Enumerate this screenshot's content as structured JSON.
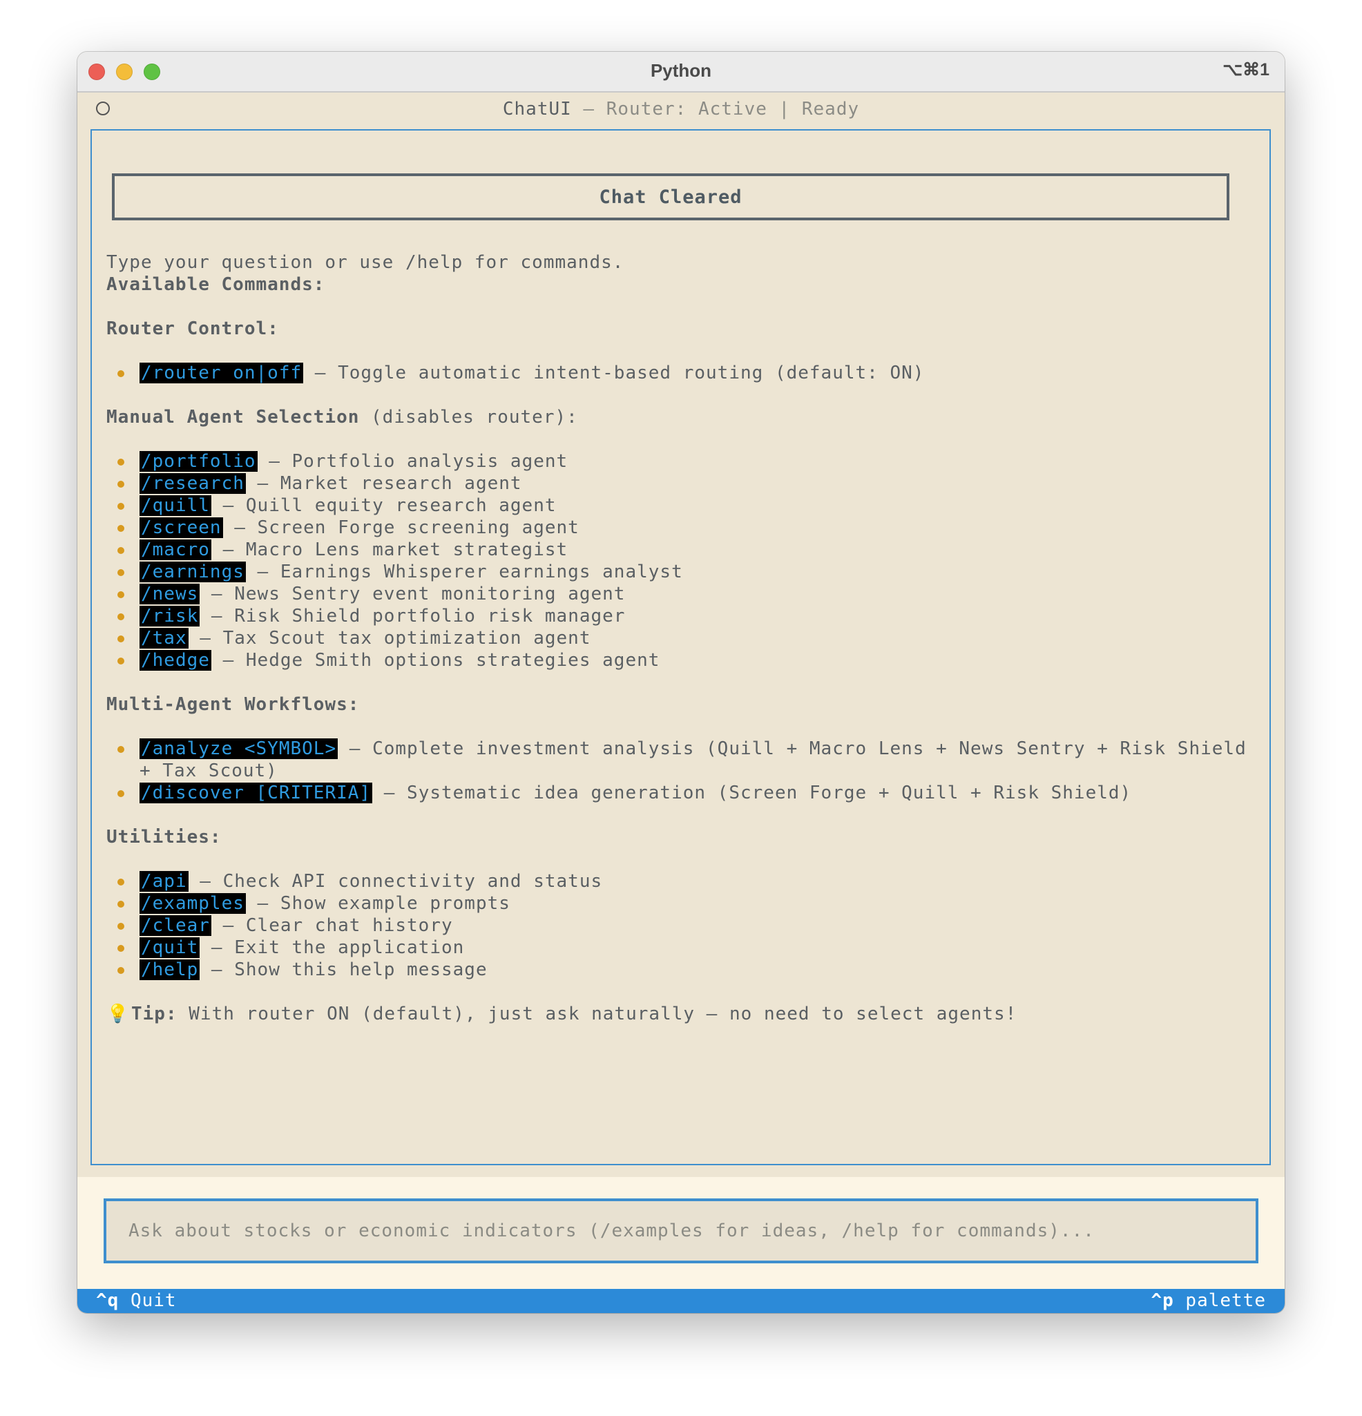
{
  "window": {
    "title": "Python",
    "shortcut": "⌥⌘1"
  },
  "header": {
    "app": "ChatUI",
    "separator": " — ",
    "status": "Router: Active | Ready"
  },
  "banner": {
    "text": "Chat Cleared"
  },
  "intro": "Type your question or use /help for commands.",
  "commands_heading": "Available Commands:",
  "sections": {
    "router": {
      "heading": "Router Control:",
      "items": [
        {
          "cmd": "/router on|off",
          "desc": " – Toggle automatic intent-based routing (default: ON)"
        }
      ]
    },
    "manual": {
      "heading": "Manual Agent Selection",
      "heading_note": " (disables router):",
      "items": [
        {
          "cmd": "/portfolio",
          "desc": " – Portfolio analysis agent"
        },
        {
          "cmd": "/research",
          "desc": " – Market research agent"
        },
        {
          "cmd": "/quill",
          "desc": " – Quill equity research agent"
        },
        {
          "cmd": "/screen",
          "desc": " – Screen Forge screening agent"
        },
        {
          "cmd": "/macro",
          "desc": " – Macro Lens market strategist"
        },
        {
          "cmd": "/earnings",
          "desc": " – Earnings Whisperer earnings analyst"
        },
        {
          "cmd": "/news",
          "desc": " – News Sentry event monitoring agent"
        },
        {
          "cmd": "/risk",
          "desc": " – Risk Shield portfolio risk manager"
        },
        {
          "cmd": "/tax",
          "desc": " – Tax Scout tax optimization agent"
        },
        {
          "cmd": "/hedge",
          "desc": " – Hedge Smith options strategies agent"
        }
      ]
    },
    "workflows": {
      "heading": "Multi-Agent Workflows:",
      "items": [
        {
          "cmd": "/analyze <SYMBOL>",
          "desc": " – Complete investment analysis (Quill + Macro Lens + News Sentry + Risk Shield + Tax Scout)"
        },
        {
          "cmd": "/discover [CRITERIA]",
          "desc": " – Systematic idea generation (Screen Forge + Quill + Risk Shield)"
        }
      ]
    },
    "utilities": {
      "heading": "Utilities:",
      "items": [
        {
          "cmd": "/api",
          "desc": " – Check API connectivity and status"
        },
        {
          "cmd": "/examples",
          "desc": " – Show example prompts"
        },
        {
          "cmd": "/clear",
          "desc": " – Clear chat history"
        },
        {
          "cmd": "/quit",
          "desc": " – Exit the application"
        },
        {
          "cmd": "/help",
          "desc": " – Show this help message"
        }
      ]
    }
  },
  "tip": {
    "icon": "lightbulb-icon",
    "glyph": "💡",
    "label": "Tip:",
    "text": " With router ON (default), just ask naturally – no need to select agents!"
  },
  "input": {
    "value": "",
    "placeholder": "Ask about stocks or economic indicators (/examples for ideas, /help for commands)..."
  },
  "footer": {
    "quit_key": "^q",
    "quit_label": " Quit",
    "palette_key": "^p",
    "palette_label": " palette"
  },
  "colors": {
    "background": "#ede5d3",
    "accent": "#3f8fce",
    "footer": "#2c8ad8",
    "bullet": "#d89a1e",
    "command_fg": "#2f9be0",
    "command_bg": "#000000"
  }
}
